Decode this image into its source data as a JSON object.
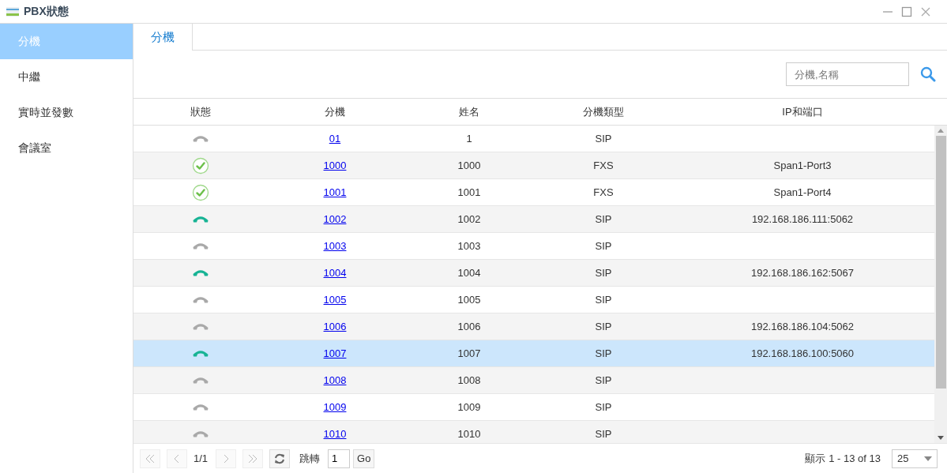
{
  "window": {
    "title": "PBX狀態"
  },
  "sidebar": {
    "items": [
      {
        "label": "分機",
        "selected": true
      },
      {
        "label": "中繼",
        "selected": false
      },
      {
        "label": "實時並發數",
        "selected": false
      },
      {
        "label": "會議室",
        "selected": false
      }
    ]
  },
  "tabs": [
    {
      "label": "分機",
      "selected": true
    }
  ],
  "search": {
    "placeholder": "分機,名稱"
  },
  "table": {
    "columns": [
      "狀態",
      "分機",
      "姓名",
      "分機類型",
      "IP和端口"
    ],
    "rows": [
      {
        "kind": "idle",
        "ext": "01",
        "name": "1",
        "type": "SIP",
        "ip": "",
        "selected": false
      },
      {
        "kind": "ok",
        "ext": "1000",
        "name": "1000",
        "type": "FXS",
        "ip": "Span1-Port3",
        "selected": false
      },
      {
        "kind": "ok",
        "ext": "1001",
        "name": "1001",
        "type": "FXS",
        "ip": "Span1-Port4",
        "selected": false
      },
      {
        "kind": "online",
        "ext": "1002",
        "name": "1002",
        "type": "SIP",
        "ip": "192.168.186.111:5062",
        "selected": false
      },
      {
        "kind": "idle",
        "ext": "1003",
        "name": "1003",
        "type": "SIP",
        "ip": "",
        "selected": false
      },
      {
        "kind": "online",
        "ext": "1004",
        "name": "1004",
        "type": "SIP",
        "ip": "192.168.186.162:5067",
        "selected": false
      },
      {
        "kind": "idle",
        "ext": "1005",
        "name": "1005",
        "type": "SIP",
        "ip": "",
        "selected": false
      },
      {
        "kind": "idle",
        "ext": "1006",
        "name": "1006",
        "type": "SIP",
        "ip": "192.168.186.104:5062",
        "selected": false
      },
      {
        "kind": "online",
        "ext": "1007",
        "name": "1007",
        "type": "SIP",
        "ip": "192.168.186.100:5060",
        "selected": true
      },
      {
        "kind": "idle",
        "ext": "1008",
        "name": "1008",
        "type": "SIP",
        "ip": "",
        "selected": false
      },
      {
        "kind": "idle",
        "ext": "1009",
        "name": "1009",
        "type": "SIP",
        "ip": "",
        "selected": false
      },
      {
        "kind": "idle",
        "ext": "1010",
        "name": "1010",
        "type": "SIP",
        "ip": "",
        "selected": false
      }
    ]
  },
  "pager": {
    "page": "1/1",
    "jump_label": "跳轉",
    "jump_value": "1",
    "go": "Go",
    "summary_label": "顯示",
    "summary": "1 - 13 of 13",
    "page_size": "25"
  }
}
